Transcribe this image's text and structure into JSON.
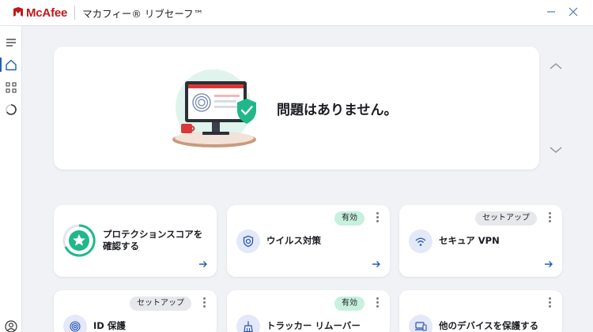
{
  "app": {
    "brand_name": "McAfee",
    "product_name": "マカフィー® リブセーフ™"
  },
  "colors": {
    "brand_red": "#c01818",
    "accent_blue": "#1f5fb8",
    "status_on": "#c7f0df",
    "status_setup": "#e7e8ec",
    "ok_shield": "#20b88a"
  },
  "sidebar": {
    "items": [
      {
        "icon": "menu-icon"
      },
      {
        "icon": "home-icon",
        "active": true
      },
      {
        "icon": "apps-grid-icon"
      },
      {
        "icon": "progress-icon"
      },
      {
        "icon": "account-icon"
      }
    ]
  },
  "hero": {
    "title": "問題はありません。",
    "illustration": "protected-monitor-illustration"
  },
  "cards": [
    {
      "label_line1": "プロテクションスコアを",
      "label_line2": "確認する",
      "icon": "star-shield-icon",
      "badge": ""
    },
    {
      "label_line1": "ウイルス対策",
      "icon": "shield-icon",
      "badge": "有効"
    },
    {
      "label_line1": "セキュア VPN",
      "icon": "vpn-icon",
      "badge": "セットアップ"
    },
    {
      "label_line1": "ID 保護",
      "icon": "fingerprint-icon",
      "badge": "セットアップ"
    },
    {
      "label_line1": "トラッカー リムーバー",
      "icon": "broom-icon",
      "badge": "有効"
    },
    {
      "label_line1": "他のデバイスを保護する",
      "icon": "devices-icon",
      "badge": ""
    }
  ]
}
